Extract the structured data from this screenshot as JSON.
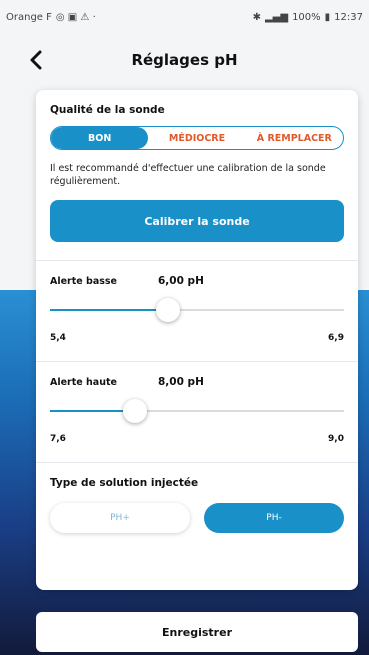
{
  "status_bar": {
    "carrier": "Orange F",
    "right_text": "100%",
    "time": "12:37"
  },
  "header": {
    "back_icon": "chevron-left-icon",
    "title": "Réglages pH"
  },
  "probe_quality": {
    "title": "Qualité de la sonde",
    "options": [
      "BON",
      "MÉDIOCRE",
      "À REMPLACER"
    ],
    "selected": "BON",
    "info": "Il est recommandé d'effectuer une calibration de la sonde régulièrement.",
    "calibrate_label": "Calibrer la sonde"
  },
  "low_alert": {
    "label": "Alerte basse",
    "value_text": "6,00 pH",
    "min": "5,4",
    "max": "6,9",
    "position": 0.4
  },
  "high_alert": {
    "label": "Alerte haute",
    "value_text": "8,00 pH",
    "min": "7,6",
    "max": "9,0",
    "position": 0.29
  },
  "injection": {
    "title": "Type de solution injectée",
    "options": [
      "PH+",
      "PH-"
    ],
    "selected": "PH-"
  },
  "save_label": "Enregistrer",
  "colors": {
    "accent": "#1a90c8",
    "warning": "#e05a2a"
  }
}
